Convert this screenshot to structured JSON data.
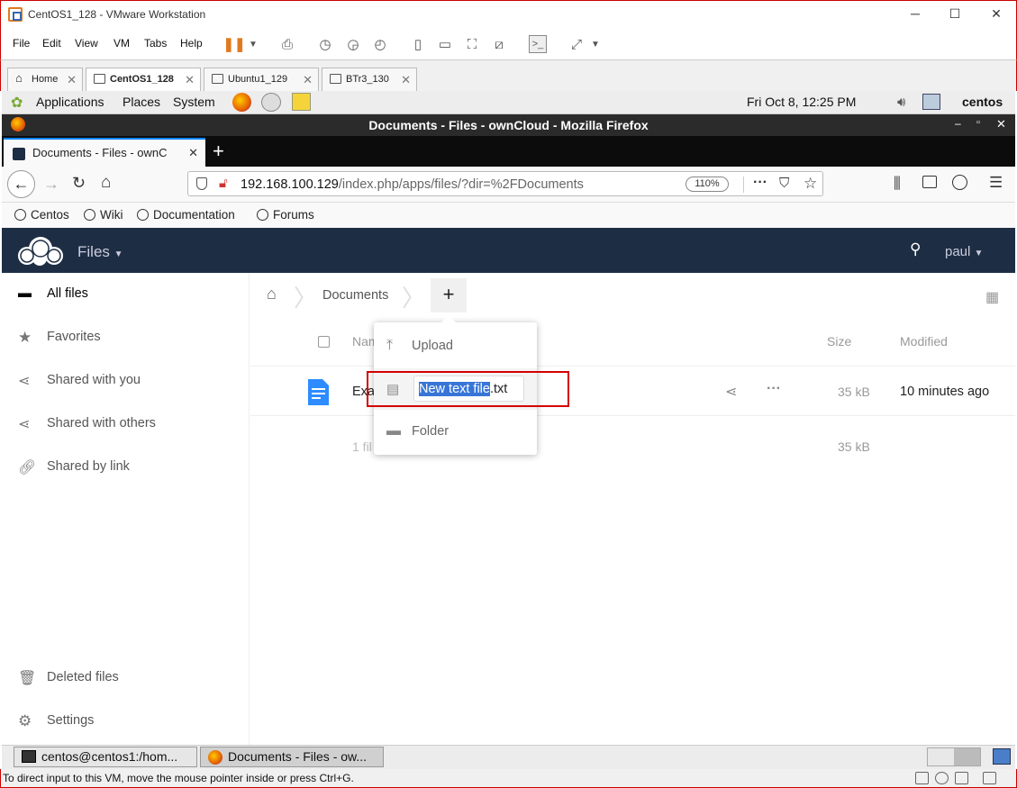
{
  "vmware": {
    "title": "CentOS1_128 - VMware Workstation",
    "menu": [
      "File",
      "Edit",
      "View",
      "VM",
      "Tabs",
      "Help"
    ],
    "tabs": [
      {
        "label": "Home",
        "active": false
      },
      {
        "label": "CentOS1_128",
        "active": true
      },
      {
        "label": "Ubuntu1_129",
        "active": false
      },
      {
        "label": "BTr3_130",
        "active": false
      }
    ],
    "status_text": "To direct input to this VM, move the mouse pointer inside or press Ctrl+G."
  },
  "gnome": {
    "menus": [
      "Applications",
      "Places",
      "System"
    ],
    "clock": "Fri Oct  8, 12:25 PM",
    "user": "centos"
  },
  "firefox": {
    "window_title": "Documents - Files - ownCloud - Mozilla Firefox",
    "tab_title": "Documents - Files - ownC",
    "url_host": "192.168.100.129",
    "url_path": "/index.php/apps/files/?dir=%2FDocuments",
    "zoom": "110%",
    "bookmarks": [
      "Centos",
      "Wiki",
      "Documentation",
      "Forums"
    ]
  },
  "owncloud": {
    "app_name": "Files",
    "user": "paul",
    "nav": [
      {
        "label": "All files",
        "icon": "folder-icon",
        "active": true
      },
      {
        "label": "Favorites",
        "icon": "star-icon"
      },
      {
        "label": "Shared with you",
        "icon": "share-icon"
      },
      {
        "label": "Shared with others",
        "icon": "share-icon"
      },
      {
        "label": "Shared by link",
        "icon": "link-icon"
      }
    ],
    "nav_bottom": [
      {
        "label": "Deleted files",
        "icon": "trash-icon"
      },
      {
        "label": "Settings",
        "icon": "gear-icon"
      }
    ],
    "breadcrumb": "Documents",
    "columns": {
      "name": "Nam",
      "size": "Size",
      "modified": "Modified"
    },
    "file_row": {
      "name": "Exa",
      "size": "35 kB",
      "modified": "10 minutes ago"
    },
    "summary": {
      "count": "1 fil",
      "size": "35 kB"
    },
    "new_menu": {
      "upload": "Upload",
      "new_file_selected": "New text file",
      "new_file_ext": ".txt",
      "folder": "Folder"
    }
  },
  "taskbar": [
    {
      "label": "centos@centos1:/hom..."
    },
    {
      "label": "Documents - Files - ow..."
    }
  ]
}
